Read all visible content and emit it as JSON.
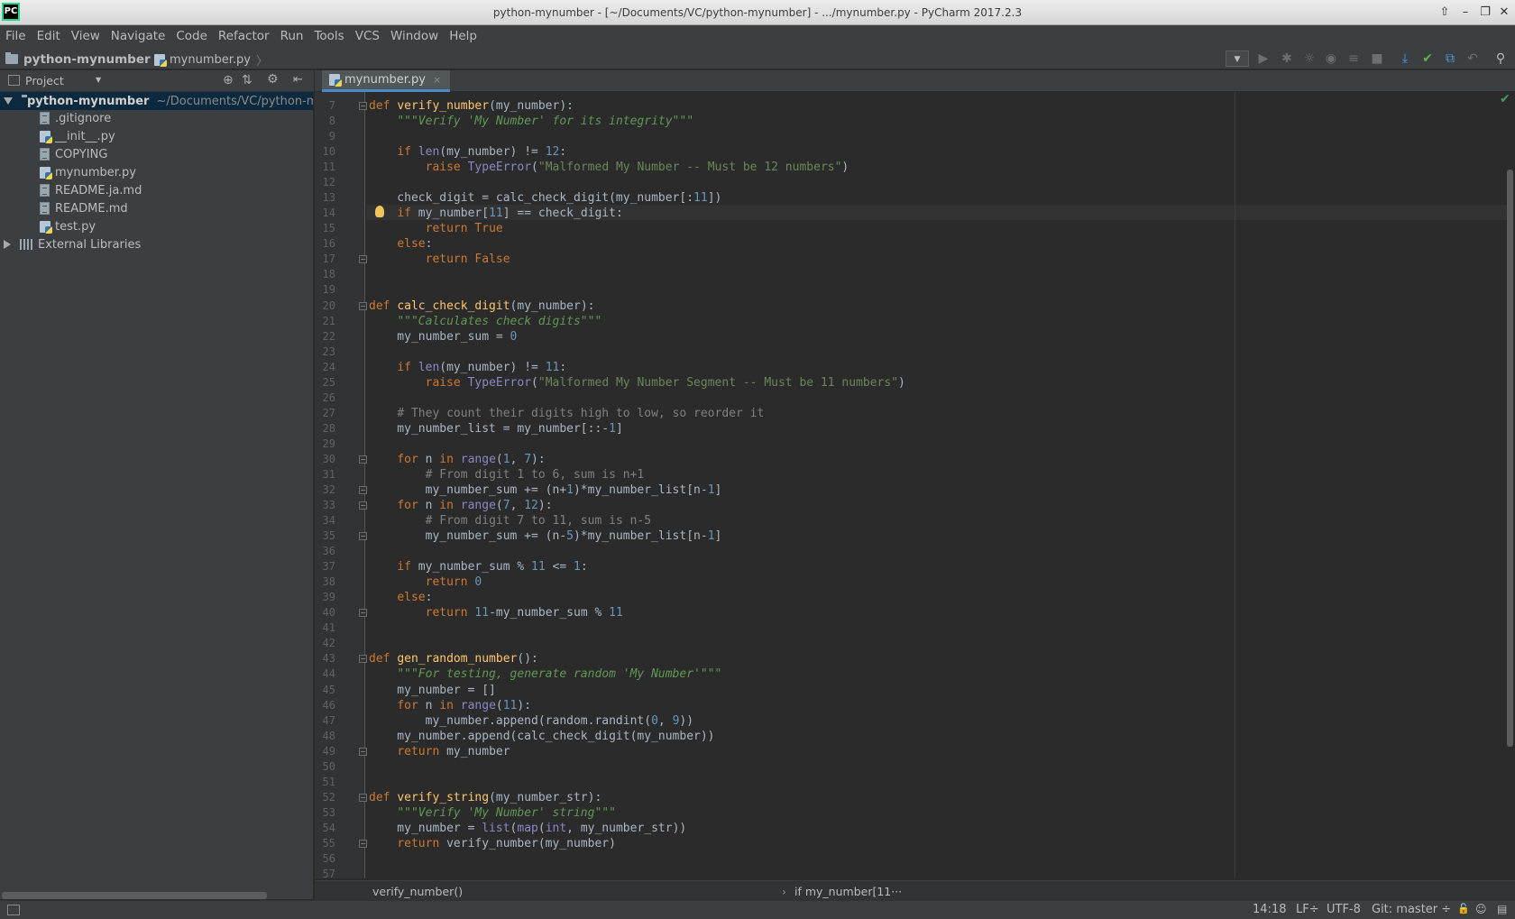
{
  "window": {
    "title": "python-mynumber - [~/Documents/VC/python-mynumber] - .../mynumber.py - PyCharm 2017.2.3",
    "app_icon_text": "PC"
  },
  "menu": [
    "File",
    "Edit",
    "View",
    "Navigate",
    "Code",
    "Refactor",
    "Run",
    "Tools",
    "VCS",
    "Window",
    "Help"
  ],
  "navbar": {
    "project": "python-mynumber",
    "file": "mynumber.py"
  },
  "project_panel": {
    "label": "Project",
    "root": {
      "name": "python-mynumber",
      "path": "~/Documents/VC/python-m"
    },
    "files": [
      ".gitignore",
      "__init__.py",
      "COPYING",
      "mynumber.py",
      "README.ja.md",
      "README.md",
      "test.py"
    ],
    "external": "External Libraries"
  },
  "tab": {
    "label": "mynumber.py",
    "close": "×"
  },
  "editor": {
    "line_numbers": [
      "7",
      "8",
      "9",
      "10",
      "11",
      "12",
      "13",
      "14",
      "15",
      "16",
      "17",
      "18",
      "19",
      "20",
      "21",
      "22",
      "23",
      "24",
      "25",
      "26",
      "27",
      "28",
      "29",
      "30",
      "31",
      "32",
      "33",
      "34",
      "35",
      "36",
      "37",
      "38",
      "39",
      "40",
      "41",
      "42",
      "43",
      "44",
      "45",
      "46",
      "47",
      "48",
      "49",
      "50",
      "51",
      "52",
      "53",
      "54",
      "55",
      "56",
      "57"
    ],
    "cursor_line": "14"
  },
  "breadcrumb": {
    "function": "verify_number()",
    "separator": "›",
    "statement": "if my_number[11···"
  },
  "status": {
    "position": "14:18",
    "line_sep": "LF÷",
    "encoding": "UTF-8",
    "vcs": "Git: master ÷"
  },
  "colors": {
    "keyword": "#cc7832",
    "function": "#ffc66d",
    "number": "#6897bb",
    "string": "#6a8759",
    "docstring": "#629755",
    "comment": "#808080",
    "builtin": "#8888c6",
    "default": "#a9b7c6"
  }
}
